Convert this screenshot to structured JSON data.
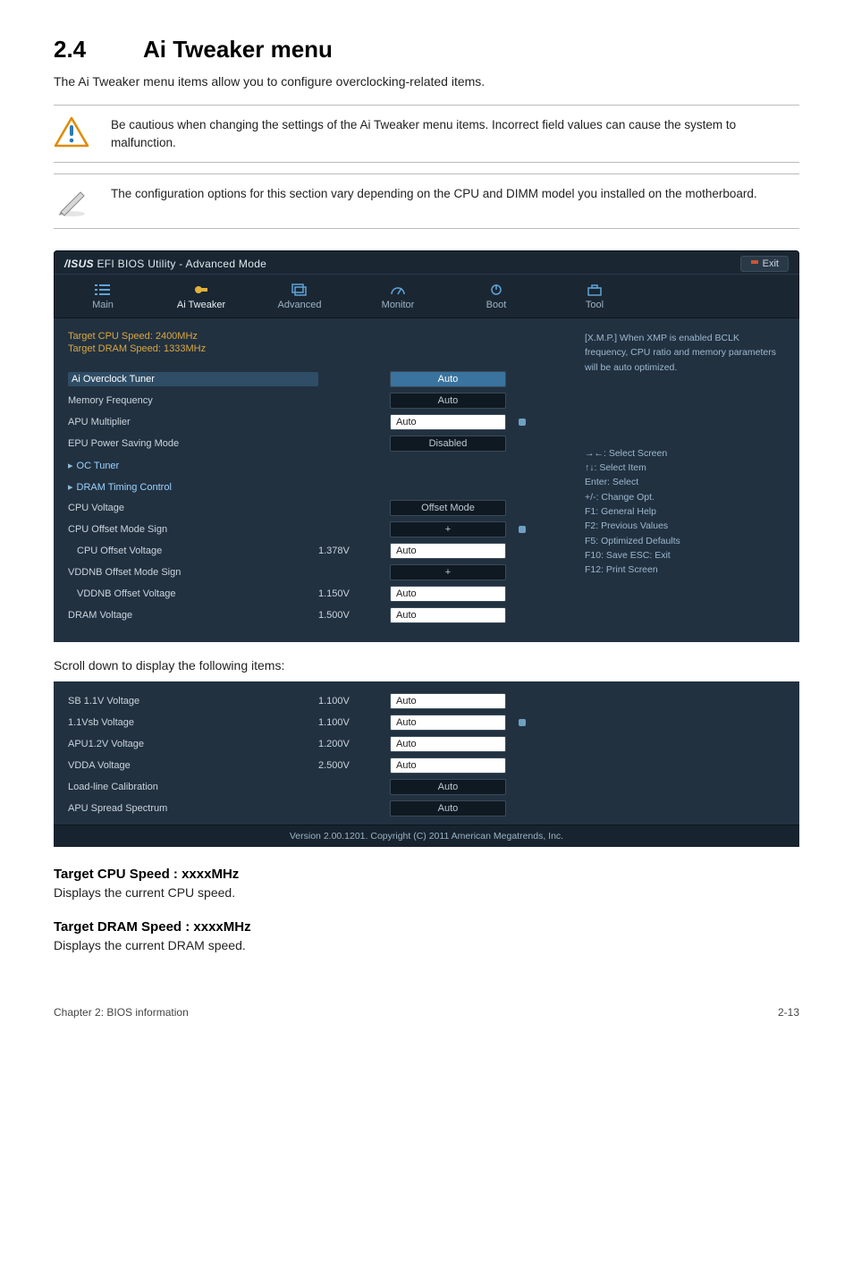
{
  "section": {
    "num": "2.4",
    "title": "Ai Tweaker menu"
  },
  "intro": "The Ai Tweaker menu items allow you to configure overclocking-related items.",
  "note_caution": "Be cautious when changing the settings of the Ai Tweaker menu items. Incorrect field values can cause the system to malfunction.",
  "note_info": "The configuration options for this section vary depending on the CPU and DIMM model you installed on the motherboard.",
  "bios": {
    "logo_text": "EFI BIOS Utility - Advanced Mode",
    "exit": "Exit",
    "tabs": {
      "main": "Main",
      "ai": "Ai  Tweaker",
      "adv": "Advanced",
      "mon": "Monitor",
      "boot": "Boot",
      "tool": "Tool"
    },
    "info": {
      "cpu": "Target CPU Speed: 2400MHz",
      "dram": "Target DRAM Speed: 1333MHz"
    },
    "rows": {
      "ai_oc": {
        "label": "Ai Overclock Tuner",
        "field": "Auto"
      },
      "mem_freq": {
        "label": "Memory Frequency",
        "field": "Auto"
      },
      "apu_mult": {
        "label": "APU Multiplier",
        "field": "Auto"
      },
      "epu": {
        "label": "EPU Power Saving Mode",
        "field": "Disabled"
      },
      "oc_tuner": {
        "label": "OC Tuner"
      },
      "dram_tc": {
        "label": "DRAM Timing Control"
      },
      "cpu_v": {
        "label": "CPU Voltage",
        "field": "Offset Mode"
      },
      "cpu_off_sign": {
        "label": "CPU Offset Mode Sign",
        "field": "+"
      },
      "cpu_off_v": {
        "label": "CPU Offset Voltage",
        "read": "1.378V",
        "field": "Auto"
      },
      "vddnb_sign": {
        "label": "VDDNB Offset Mode Sign",
        "field": "+"
      },
      "vddnb_v": {
        "label": "VDDNB Offset Voltage",
        "read": "1.150V",
        "field": "Auto"
      },
      "dram_v": {
        "label": "DRAM Voltage",
        "read": "1.500V",
        "field": "Auto"
      }
    },
    "help_top": "[X.M.P.] When XMP is enabled BCLK frequency, CPU ratio and memory parameters will be auto optimized.",
    "help_keys": {
      "l1": "→←: Select Screen",
      "l2": "↑↓: Select Item",
      "l3": "Enter: Select",
      "l4": "+/-: Change Opt.",
      "l5": "F1: General Help",
      "l6": "F2: Previous Values",
      "l7": "F5: Optimized Defaults",
      "l8": "F10: Save   ESC: Exit",
      "l9": "F12: Print Screen"
    }
  },
  "scroll_desc": "Scroll down to display the following items:",
  "bios2": {
    "rows": {
      "sb11": {
        "label": "SB 1.1V Voltage",
        "read": "1.100V",
        "field": "Auto"
      },
      "vsb11": {
        "label": "1.1Vsb Voltage",
        "read": "1.100V",
        "field": "Auto"
      },
      "apu12": {
        "label": "APU1.2V Voltage",
        "read": "1.200V",
        "field": "Auto"
      },
      "vdda": {
        "label": "VDDA Voltage",
        "read": "2.500V",
        "field": "Auto"
      },
      "llc": {
        "label": "Load-line Calibration",
        "field": "Auto"
      },
      "apu_ss": {
        "label": "APU Spread Spectrum",
        "field": "Auto"
      }
    },
    "version": "Version 2.00.1201.   Copyright (C) 2011 American Megatrends, Inc."
  },
  "sub1": {
    "h": "Target CPU Speed : xxxxMHz",
    "p": "Displays the current CPU speed."
  },
  "sub2": {
    "h": "Target DRAM Speed : xxxxMHz",
    "p": "Displays the current DRAM speed."
  },
  "footer": {
    "left": "Chapter 2: BIOS information",
    "right": "2-13"
  }
}
